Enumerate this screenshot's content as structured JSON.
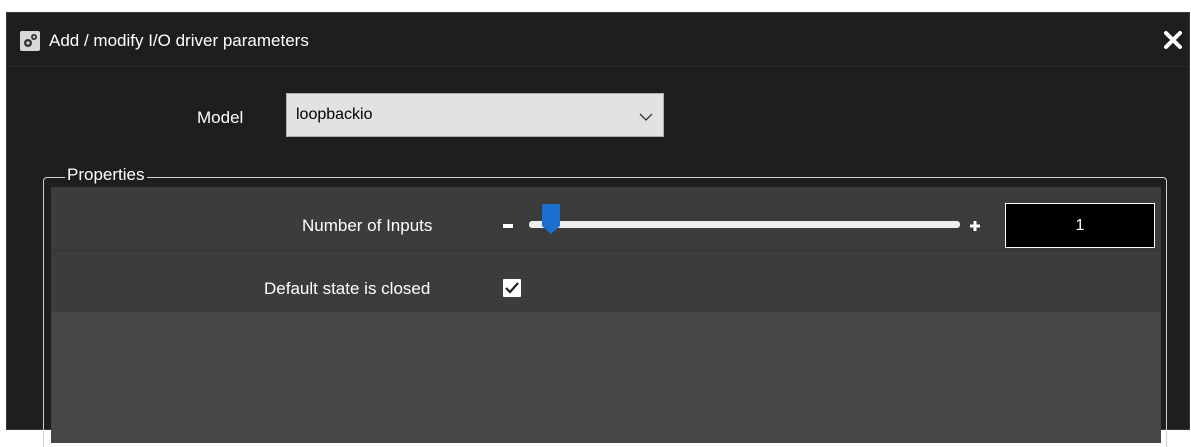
{
  "window": {
    "title": "Add / modify I/O driver parameters",
    "title_icon": "gears-icon",
    "close_icon": "close-icon"
  },
  "model": {
    "label": "Model",
    "selected": "loopbackio"
  },
  "properties": {
    "group_label": "Properties",
    "number_of_inputs": {
      "label": "Number of Inputs",
      "value": "1",
      "slider_fraction": 0.05
    },
    "default_state": {
      "label": "Default state is closed",
      "checked": true
    }
  },
  "colors": {
    "window_bg": "#1e1e1e",
    "panel_bg": "#474747",
    "row_bg": "#3c3c3c",
    "slider_thumb": "#1a6fd1"
  }
}
